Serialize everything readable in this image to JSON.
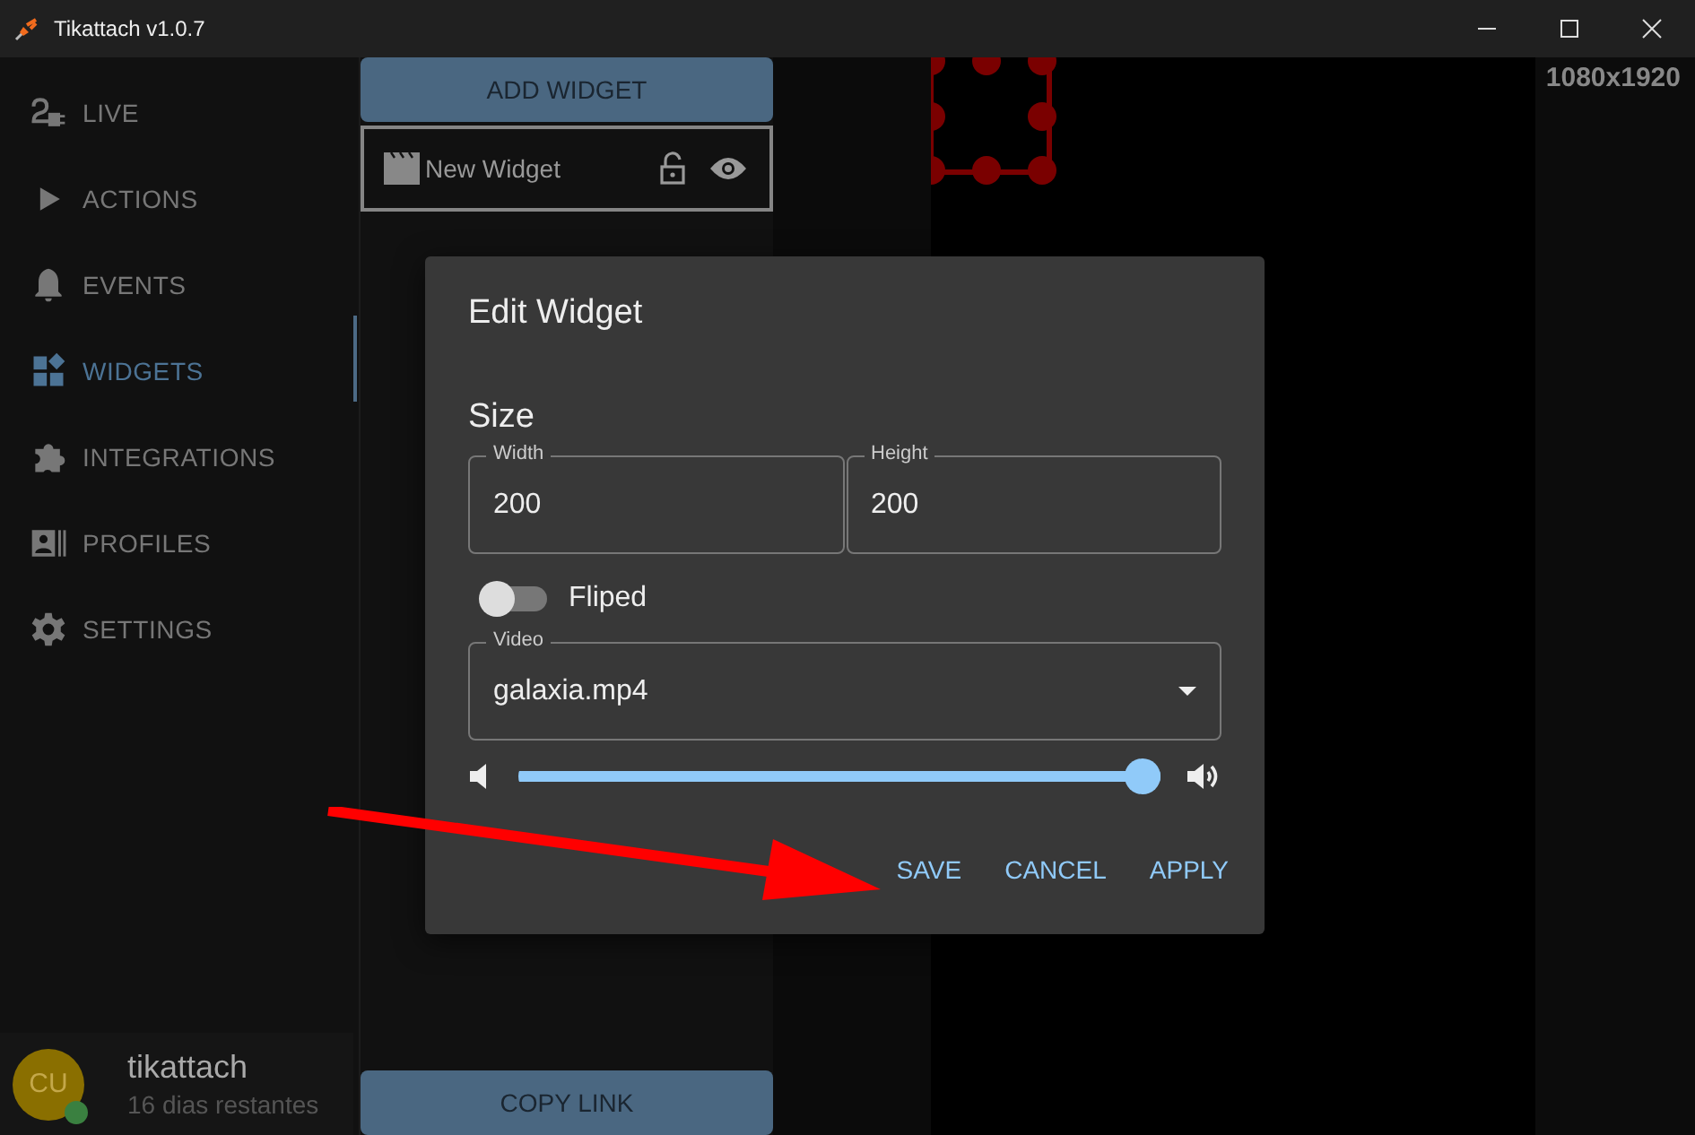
{
  "window": {
    "title": "Tikattach v1.0.7"
  },
  "sidebar": {
    "items": [
      {
        "label": "LIVE",
        "selected": false
      },
      {
        "label": "ACTIONS",
        "selected": false
      },
      {
        "label": "EVENTS",
        "selected": false
      },
      {
        "label": "WIDGETS",
        "selected": true
      },
      {
        "label": "INTEGRATIONS",
        "selected": false
      },
      {
        "label": "PROFILES",
        "selected": false
      },
      {
        "label": "SETTINGS",
        "selected": false
      }
    ],
    "user": {
      "initials": "CU",
      "name": "tikattach",
      "subtitle": "16 dias restantes",
      "online": true
    }
  },
  "widgets_panel": {
    "add_button": "ADD WIDGET",
    "widgets": [
      {
        "name": "New Widget",
        "locked": false,
        "visible": true
      }
    ],
    "copy_button": "COPY LINK"
  },
  "canvas": {
    "resolution": "1080x1920"
  },
  "dialog": {
    "title": "Edit Widget",
    "section": "Size",
    "fields": [
      {
        "label": "Width",
        "value": "200"
      },
      {
        "label": "Height",
        "value": "200"
      }
    ],
    "flipped": {
      "label": "Fliped",
      "on": false
    },
    "video": {
      "label": "Video",
      "value": "galaxia.mp4"
    },
    "volume": {
      "level": 1
    },
    "actions": [
      "SAVE",
      "CANCEL",
      "APPLY"
    ]
  }
}
